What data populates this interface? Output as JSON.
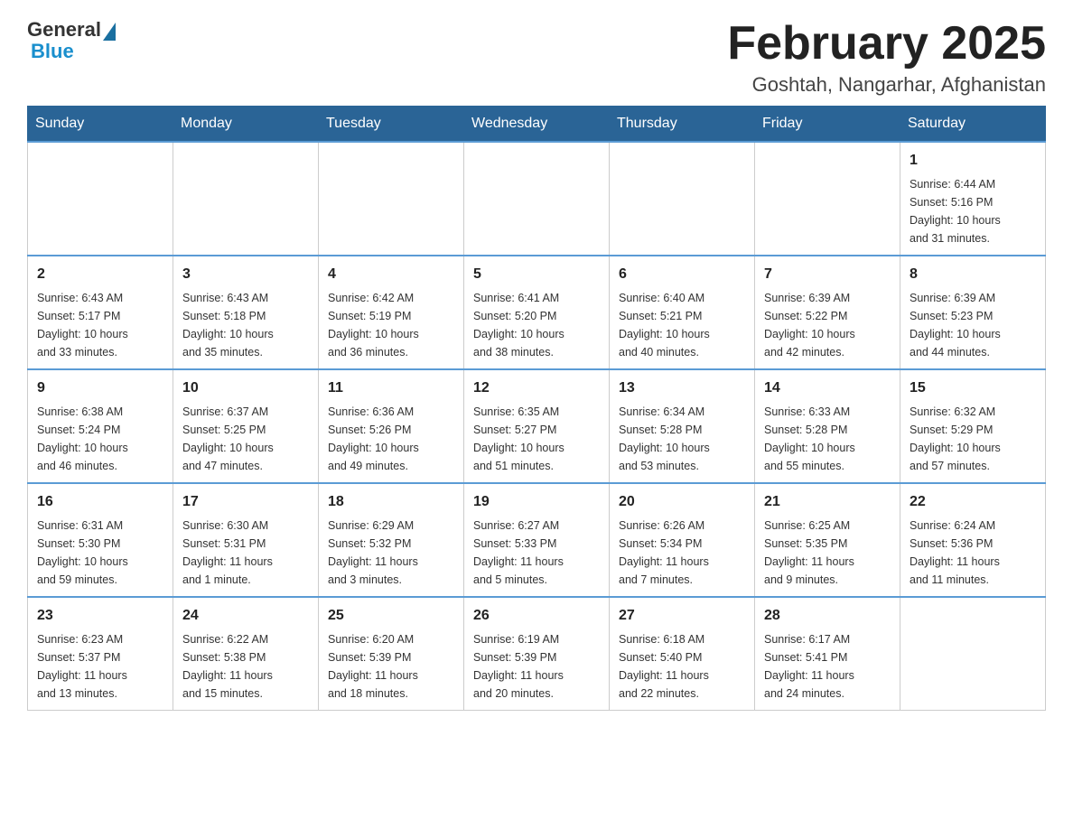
{
  "header": {
    "logo": {
      "general": "General",
      "blue": "Blue"
    },
    "title": "February 2025",
    "subtitle": "Goshtah, Nangarhar, Afghanistan"
  },
  "weekdays": [
    "Sunday",
    "Monday",
    "Tuesday",
    "Wednesday",
    "Thursday",
    "Friday",
    "Saturday"
  ],
  "weeks": [
    [
      {
        "day": "",
        "info": ""
      },
      {
        "day": "",
        "info": ""
      },
      {
        "day": "",
        "info": ""
      },
      {
        "day": "",
        "info": ""
      },
      {
        "day": "",
        "info": ""
      },
      {
        "day": "",
        "info": ""
      },
      {
        "day": "1",
        "info": "Sunrise: 6:44 AM\nSunset: 5:16 PM\nDaylight: 10 hours\nand 31 minutes."
      }
    ],
    [
      {
        "day": "2",
        "info": "Sunrise: 6:43 AM\nSunset: 5:17 PM\nDaylight: 10 hours\nand 33 minutes."
      },
      {
        "day": "3",
        "info": "Sunrise: 6:43 AM\nSunset: 5:18 PM\nDaylight: 10 hours\nand 35 minutes."
      },
      {
        "day": "4",
        "info": "Sunrise: 6:42 AM\nSunset: 5:19 PM\nDaylight: 10 hours\nand 36 minutes."
      },
      {
        "day": "5",
        "info": "Sunrise: 6:41 AM\nSunset: 5:20 PM\nDaylight: 10 hours\nand 38 minutes."
      },
      {
        "day": "6",
        "info": "Sunrise: 6:40 AM\nSunset: 5:21 PM\nDaylight: 10 hours\nand 40 minutes."
      },
      {
        "day": "7",
        "info": "Sunrise: 6:39 AM\nSunset: 5:22 PM\nDaylight: 10 hours\nand 42 minutes."
      },
      {
        "day": "8",
        "info": "Sunrise: 6:39 AM\nSunset: 5:23 PM\nDaylight: 10 hours\nand 44 minutes."
      }
    ],
    [
      {
        "day": "9",
        "info": "Sunrise: 6:38 AM\nSunset: 5:24 PM\nDaylight: 10 hours\nand 46 minutes."
      },
      {
        "day": "10",
        "info": "Sunrise: 6:37 AM\nSunset: 5:25 PM\nDaylight: 10 hours\nand 47 minutes."
      },
      {
        "day": "11",
        "info": "Sunrise: 6:36 AM\nSunset: 5:26 PM\nDaylight: 10 hours\nand 49 minutes."
      },
      {
        "day": "12",
        "info": "Sunrise: 6:35 AM\nSunset: 5:27 PM\nDaylight: 10 hours\nand 51 minutes."
      },
      {
        "day": "13",
        "info": "Sunrise: 6:34 AM\nSunset: 5:28 PM\nDaylight: 10 hours\nand 53 minutes."
      },
      {
        "day": "14",
        "info": "Sunrise: 6:33 AM\nSunset: 5:28 PM\nDaylight: 10 hours\nand 55 minutes."
      },
      {
        "day": "15",
        "info": "Sunrise: 6:32 AM\nSunset: 5:29 PM\nDaylight: 10 hours\nand 57 minutes."
      }
    ],
    [
      {
        "day": "16",
        "info": "Sunrise: 6:31 AM\nSunset: 5:30 PM\nDaylight: 10 hours\nand 59 minutes."
      },
      {
        "day": "17",
        "info": "Sunrise: 6:30 AM\nSunset: 5:31 PM\nDaylight: 11 hours\nand 1 minute."
      },
      {
        "day": "18",
        "info": "Sunrise: 6:29 AM\nSunset: 5:32 PM\nDaylight: 11 hours\nand 3 minutes."
      },
      {
        "day": "19",
        "info": "Sunrise: 6:27 AM\nSunset: 5:33 PM\nDaylight: 11 hours\nand 5 minutes."
      },
      {
        "day": "20",
        "info": "Sunrise: 6:26 AM\nSunset: 5:34 PM\nDaylight: 11 hours\nand 7 minutes."
      },
      {
        "day": "21",
        "info": "Sunrise: 6:25 AM\nSunset: 5:35 PM\nDaylight: 11 hours\nand 9 minutes."
      },
      {
        "day": "22",
        "info": "Sunrise: 6:24 AM\nSunset: 5:36 PM\nDaylight: 11 hours\nand 11 minutes."
      }
    ],
    [
      {
        "day": "23",
        "info": "Sunrise: 6:23 AM\nSunset: 5:37 PM\nDaylight: 11 hours\nand 13 minutes."
      },
      {
        "day": "24",
        "info": "Sunrise: 6:22 AM\nSunset: 5:38 PM\nDaylight: 11 hours\nand 15 minutes."
      },
      {
        "day": "25",
        "info": "Sunrise: 6:20 AM\nSunset: 5:39 PM\nDaylight: 11 hours\nand 18 minutes."
      },
      {
        "day": "26",
        "info": "Sunrise: 6:19 AM\nSunset: 5:39 PM\nDaylight: 11 hours\nand 20 minutes."
      },
      {
        "day": "27",
        "info": "Sunrise: 6:18 AM\nSunset: 5:40 PM\nDaylight: 11 hours\nand 22 minutes."
      },
      {
        "day": "28",
        "info": "Sunrise: 6:17 AM\nSunset: 5:41 PM\nDaylight: 11 hours\nand 24 minutes."
      },
      {
        "day": "",
        "info": ""
      }
    ]
  ]
}
